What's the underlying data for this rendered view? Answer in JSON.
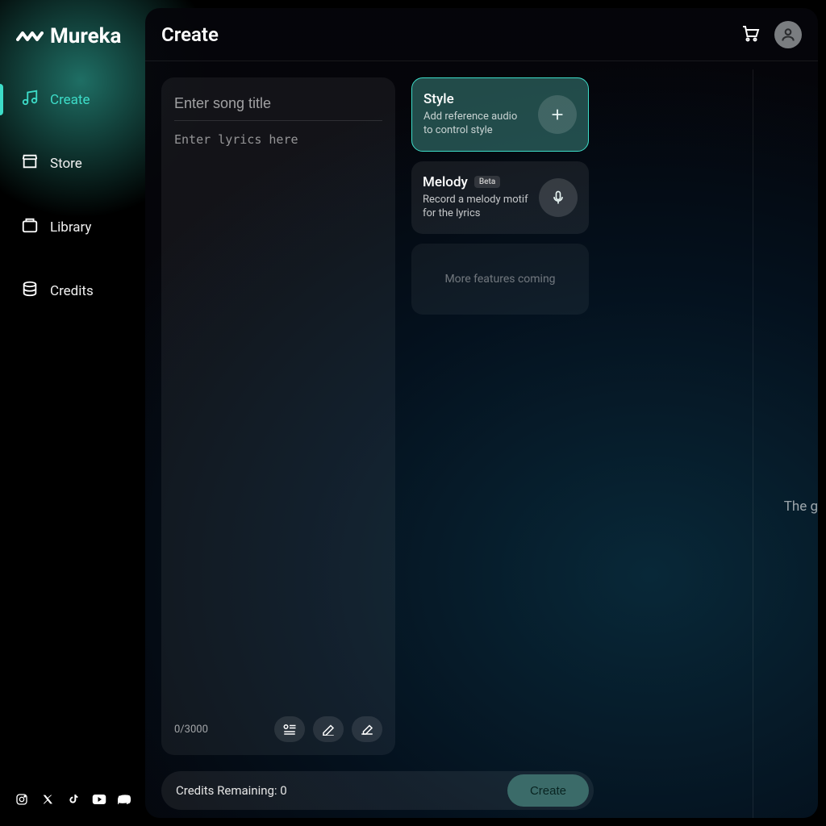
{
  "brand": {
    "name": "Mureka"
  },
  "sidebar": {
    "items": [
      {
        "label": "Create",
        "active": true
      },
      {
        "label": "Store",
        "active": false
      },
      {
        "label": "Library",
        "active": false
      },
      {
        "label": "Credits",
        "active": false
      }
    ]
  },
  "header": {
    "title": "Create"
  },
  "editor": {
    "title_placeholder": "Enter song title",
    "lyrics_placeholder": "Enter lyrics here",
    "char_count": "0/3000"
  },
  "cards": {
    "style": {
      "title": "Style",
      "desc": "Add reference audio to control style"
    },
    "melody": {
      "title": "Melody",
      "badge": "Beta",
      "desc": "Record a melody motif for the lyrics"
    },
    "coming": "More features coming"
  },
  "footer": {
    "credits_label": "Credits Remaining: 0",
    "create_label": "Create"
  },
  "hint": "The g",
  "colors": {
    "accent": "#3ddcc8"
  }
}
